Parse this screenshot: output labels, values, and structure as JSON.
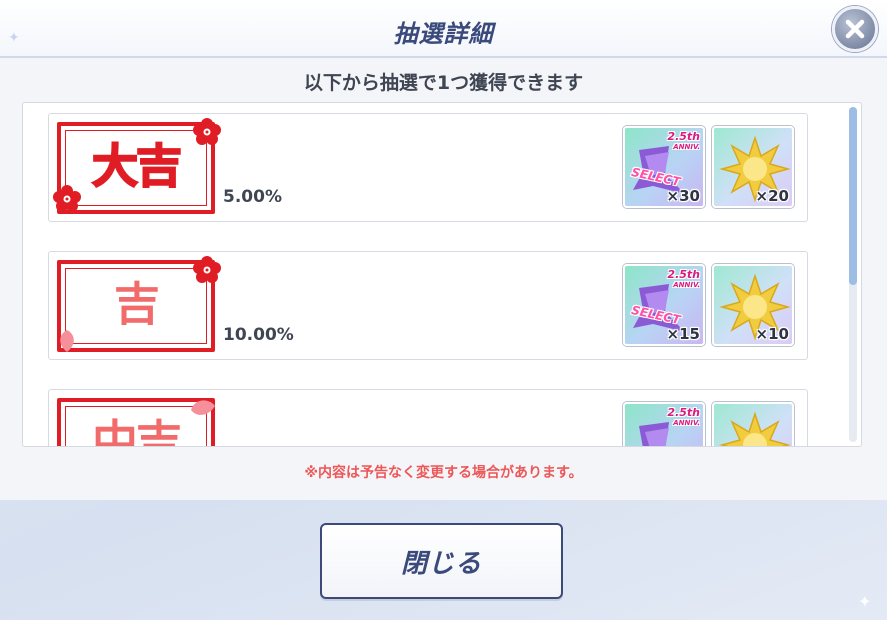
{
  "header": {
    "title": "抽選詳細",
    "close_icon": "close-icon"
  },
  "panel": {
    "subtitle": "以下から抽選で1つ獲得できます",
    "notice": "※内容は予告なく変更する場合があります。"
  },
  "entries": [
    {
      "fortune": "大吉",
      "rate": "5.00%",
      "items": [
        {
          "kind": "select-ticket",
          "badge": "2.5th",
          "badge_sub": "ANNIV.",
          "label": "SELECT",
          "qty": "×30"
        },
        {
          "kind": "gold-star",
          "qty": "×20"
        }
      ]
    },
    {
      "fortune": "吉",
      "rate": "10.00%",
      "items": [
        {
          "kind": "select-ticket",
          "badge": "2.5th",
          "badge_sub": "ANNIV.",
          "label": "SELECT",
          "qty": "×15"
        },
        {
          "kind": "gold-star",
          "qty": "×10"
        }
      ]
    },
    {
      "fortune": "中吉",
      "rate": "",
      "items": [
        {
          "kind": "select-ticket",
          "badge": "2.5th",
          "badge_sub": "ANNIV.",
          "label": "",
          "qty": ""
        },
        {
          "kind": "gold-star",
          "qty": ""
        }
      ]
    }
  ],
  "footer": {
    "close_label": "閉じる"
  },
  "colors": {
    "accent": "#3b4a7c",
    "fortune_red": "#e01c24",
    "notice_red": "#ec5757",
    "scroll_thumb": "#9dbde4"
  }
}
